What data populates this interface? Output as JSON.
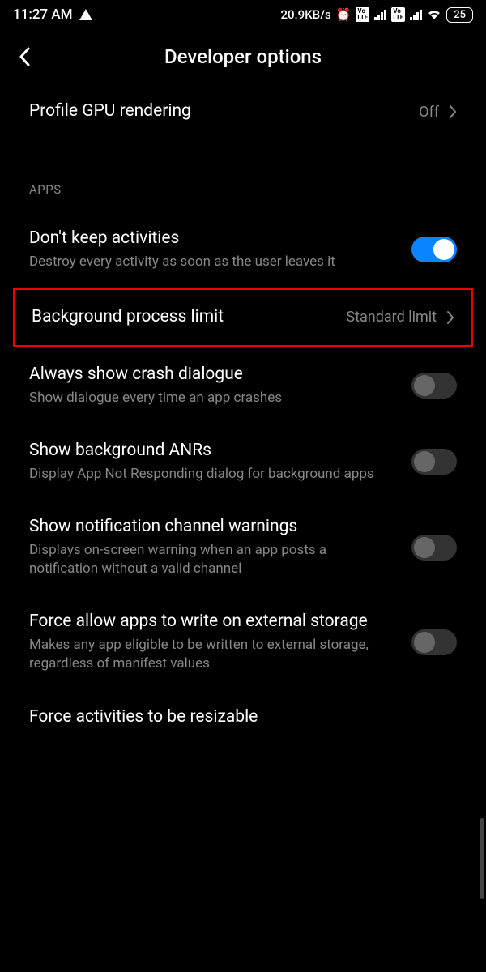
{
  "statusBar": {
    "time": "11:27 AM",
    "dataRate": "20.9KB/s",
    "battery": "25"
  },
  "header": {
    "title": "Developer options"
  },
  "settings": {
    "profileGpu": {
      "title": "Profile GPU rendering",
      "value": "Off"
    },
    "sectionApps": "APPS",
    "dontKeepActivities": {
      "title": "Don't keep activities",
      "subtitle": "Destroy every activity as soon as the user leaves it"
    },
    "bgProcessLimit": {
      "title": "Background process limit",
      "value": "Standard limit"
    },
    "crashDialogue": {
      "title": "Always show crash dialogue",
      "subtitle": "Show dialogue every time an app crashes"
    },
    "bgAnrs": {
      "title": "Show background ANRs",
      "subtitle": "Display App Not Responding dialog for background apps"
    },
    "notifWarnings": {
      "title": "Show notification channel warnings",
      "subtitle": "Displays on-screen warning when an app posts a notification without a valid channel"
    },
    "externalStorage": {
      "title": "Force allow apps to write on external storage",
      "subtitle": "Makes any app eligible to be written to external storage, regardless of manifest values"
    },
    "resizable": {
      "title": "Force activities to be resizable"
    }
  }
}
